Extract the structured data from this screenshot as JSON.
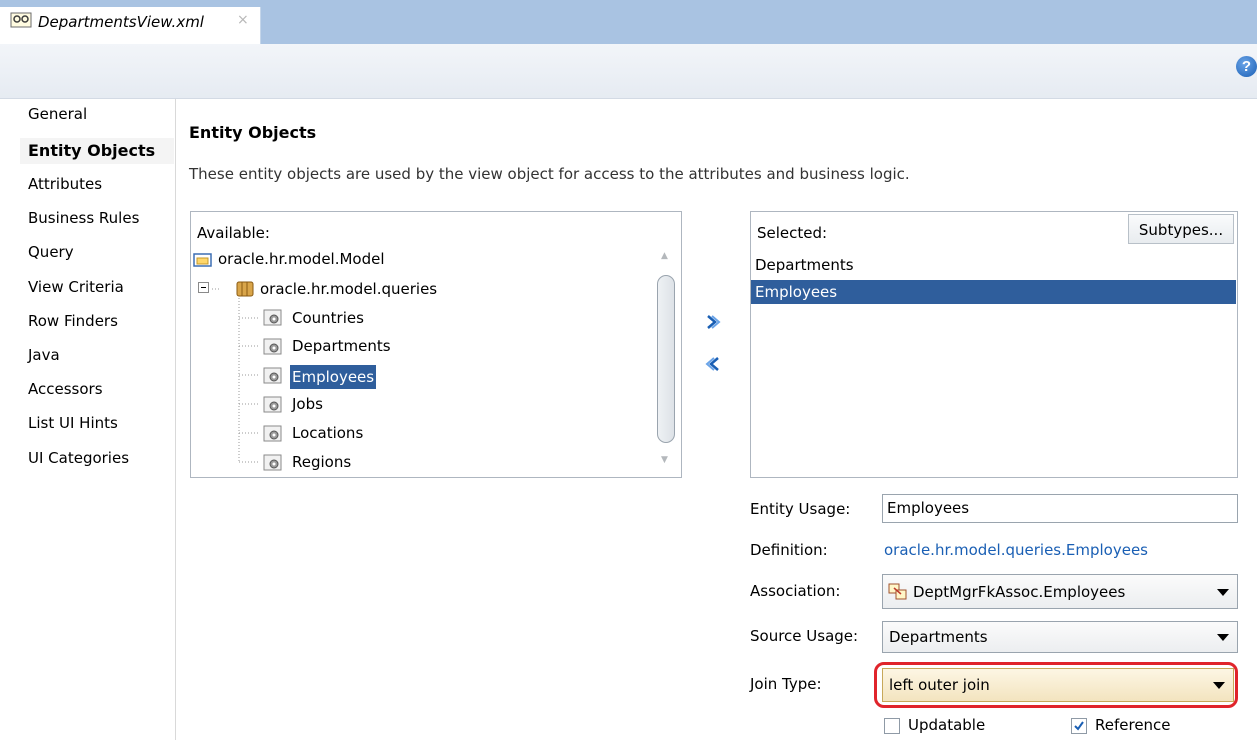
{
  "tab": {
    "title": "DepartmentsView.xml",
    "close": "×",
    "icon": "xml-file-icon"
  },
  "help": {
    "label": "?",
    "icon": "help-icon"
  },
  "nav": {
    "items": [
      {
        "label": "General"
      },
      {
        "label": "Entity Objects",
        "selected": true
      },
      {
        "label": "Attributes"
      },
      {
        "label": "Business Rules"
      },
      {
        "label": "Query"
      },
      {
        "label": "View Criteria"
      },
      {
        "label": "Row Finders"
      },
      {
        "label": "Java"
      },
      {
        "label": "Accessors"
      },
      {
        "label": "List UI Hints"
      },
      {
        "label": "UI Categories"
      }
    ]
  },
  "section": {
    "title": "Entity Objects",
    "description": "These entity objects are used by the view object for access to the attributes and business logic."
  },
  "available": {
    "label": "Available:",
    "tree": {
      "root": "oracle.hr.model.Model",
      "package": "oracle.hr.model.queries",
      "children": [
        "Countries",
        "Departments",
        "Employees",
        "Jobs",
        "Locations",
        "Regions"
      ],
      "selected": "Employees"
    }
  },
  "shuttle": {
    "add_icon": "double-chevron-right-icon",
    "remove_icon": "double-chevron-left-icon"
  },
  "selected": {
    "label": "Selected:",
    "subtypes_button": "Subtypes...",
    "items": [
      "Departments",
      "Employees"
    ],
    "selected_item": "Employees"
  },
  "form": {
    "entity_usage": {
      "label": "Entity Usage:",
      "value": "Employees"
    },
    "definition": {
      "label": "Definition:",
      "value": "oracle.hr.model.queries.Employees"
    },
    "association": {
      "label": "Association:",
      "value": "DeptMgrFkAssoc.Employees"
    },
    "source_usage": {
      "label": "Source Usage:",
      "value": "Departments"
    },
    "join_type": {
      "label": "Join Type:",
      "value": "left outer join"
    },
    "updatable": {
      "label": "Updatable",
      "checked": false
    },
    "reference": {
      "label": "Reference",
      "checked": true
    }
  },
  "colors": {
    "selection": "#2f5e9c",
    "link": "#1a5fb4",
    "highlight": "#e0242b",
    "tabbar": "#a9c3e2"
  }
}
